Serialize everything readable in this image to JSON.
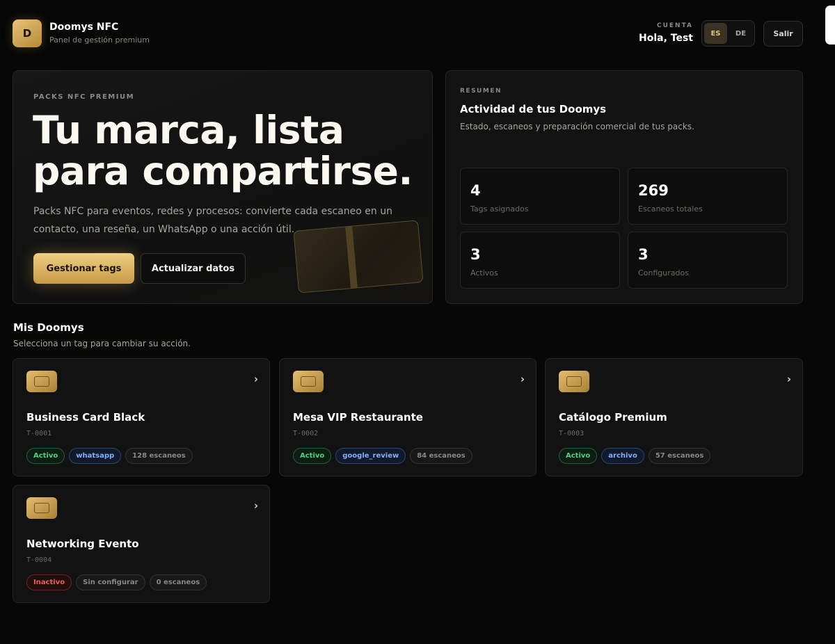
{
  "header": {
    "logo_letter": "D",
    "brand_name": "Doomys NFC",
    "brand_sub": "Panel de gestión premium",
    "account_label": "CUENTA",
    "account_greeting": "Hola, Test",
    "languages": [
      {
        "label": "ES",
        "active": true
      },
      {
        "label": "DE",
        "active": false
      }
    ],
    "logout_label": "Salir"
  },
  "hero": {
    "kicker": "PACKS NFC PREMIUM",
    "title": "Tu marca, lista para compartirse.",
    "description": "Packs NFC para eventos, redes y procesos: convierte cada escaneo en un contacto, una reseña, un WhatsApp o una acción útil.",
    "primary_button": "Gestionar tags",
    "secondary_button": "Actualizar datos"
  },
  "summary": {
    "kicker": "RESUMEN",
    "title": "Actividad de tus Doomys",
    "subtitle": "Estado, escaneos y preparación comercial de tus packs.",
    "stats": [
      {
        "value": "4",
        "label": "Tags asignados"
      },
      {
        "value": "269",
        "label": "Escaneos totales"
      },
      {
        "value": "3",
        "label": "Activos"
      },
      {
        "value": "3",
        "label": "Configurados"
      }
    ]
  },
  "tags_section": {
    "title": "Mis Doomys",
    "subtitle": "Selecciona un tag para cambiar su acción.",
    "tags": [
      {
        "name": "Business Card Black",
        "id": "T-0001",
        "status": "Activo",
        "status_color": "green",
        "action": "whatsapp",
        "action_color": "blue",
        "scans": "128 escaneos"
      },
      {
        "name": "Mesa VIP Restaurante",
        "id": "T-0002",
        "status": "Activo",
        "status_color": "green",
        "action": "google_review",
        "action_color": "blue",
        "scans": "84 escaneos"
      },
      {
        "name": "Catálogo Premium",
        "id": "T-0003",
        "status": "Activo",
        "status_color": "green",
        "action": "archivo",
        "action_color": "blue",
        "scans": "57 escaneos"
      },
      {
        "name": "Networking Evento",
        "id": "T-0004",
        "status": "Inactivo",
        "status_color": "red",
        "action": "Sin configurar",
        "action_color": "gray",
        "scans": "0 escaneos"
      }
    ]
  },
  "colors": {
    "gold": "#e9c47a",
    "background": "#070707",
    "active_green": "#4cd37a",
    "action_blue": "#7fb0ff",
    "inactive_red": "#f05a5a"
  },
  "icons": {
    "chip": "nfc-chip-icon",
    "chevron": "chevron-right-icon"
  }
}
